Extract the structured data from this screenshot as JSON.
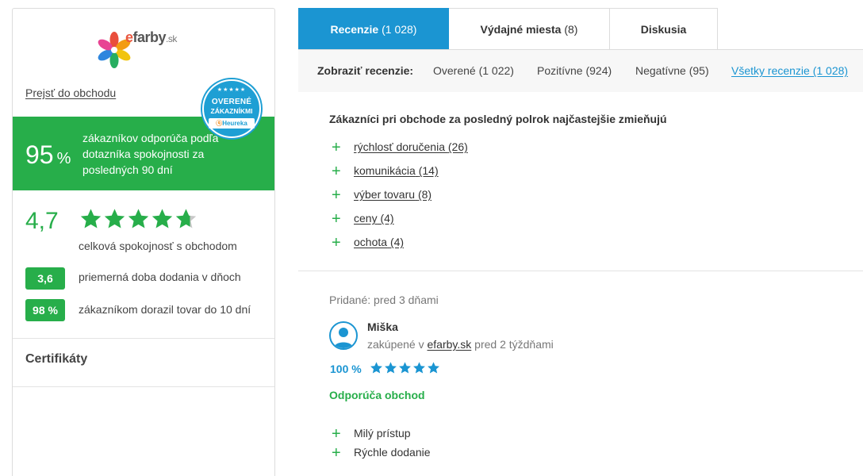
{
  "colors": {
    "green": "#27ae4a",
    "blue": "#1b95d2",
    "badge_blue": "#1e9fd4"
  },
  "sidebar": {
    "logo_e": "e",
    "logo_main": "farby",
    "logo_tld": ".sk",
    "shop_link": "Prejsť do obchodu",
    "badge": {
      "stars": "★★★★★",
      "line1": "OVERENÉ",
      "line2": "ZÁKAZNÍKMI",
      "brand": "Heureka"
    },
    "recommend_pct": "95",
    "recommend_unit": "%",
    "recommend_text": "zákazníkov odporúča podľa dotazníka spokojnosti za posledných 90 dní",
    "rating": "4,7",
    "rating_stars": 4.7,
    "rating_label": "celková spokojnosť s obchodom",
    "metrics": [
      {
        "value": "3,6",
        "label": "priemerná doba dodania v dňoch"
      },
      {
        "value": "98 %",
        "label": "zákazníkom dorazil tovar do 10 dní"
      }
    ],
    "certificates_title": "Certifikáty"
  },
  "tabs": [
    {
      "label": "Recenzie",
      "count": "(1 028)",
      "active": true
    },
    {
      "label": "Výdajné miesta",
      "count": "(8)",
      "active": false
    },
    {
      "label": "Diskusia",
      "count": "",
      "active": false
    }
  ],
  "filters": {
    "label": "Zobraziť recenzie:",
    "items": [
      {
        "label": "Overené (1 022)"
      },
      {
        "label": "Pozitívne (924)"
      },
      {
        "label": "Negatívne (95)"
      },
      {
        "label": "Všetky recenzie (1 028)"
      }
    ]
  },
  "mentions": {
    "title": "Zákazníci pri obchode za posledný polrok najčastejšie zmieňujú",
    "items": [
      {
        "label": "rýchlosť doručenia",
        "count": "(26)"
      },
      {
        "label": "komunikácia",
        "count": "(14)"
      },
      {
        "label": "výber tovaru",
        "count": "(8)"
      },
      {
        "label": "ceny",
        "count": "(4)"
      },
      {
        "label": "ochota",
        "count": "(4)"
      }
    ]
  },
  "review": {
    "added": "Pridané: pred 3 dňami",
    "author": "Miška",
    "bought_prefix": "zakúpené v",
    "shop": "efarby.sk",
    "bought_suffix": "pred 2 týždňami",
    "score": "100 %",
    "stars": 5,
    "recommendation": "Odporúča obchod",
    "pros": [
      "Milý prístup",
      "Rýchle dodanie"
    ]
  }
}
